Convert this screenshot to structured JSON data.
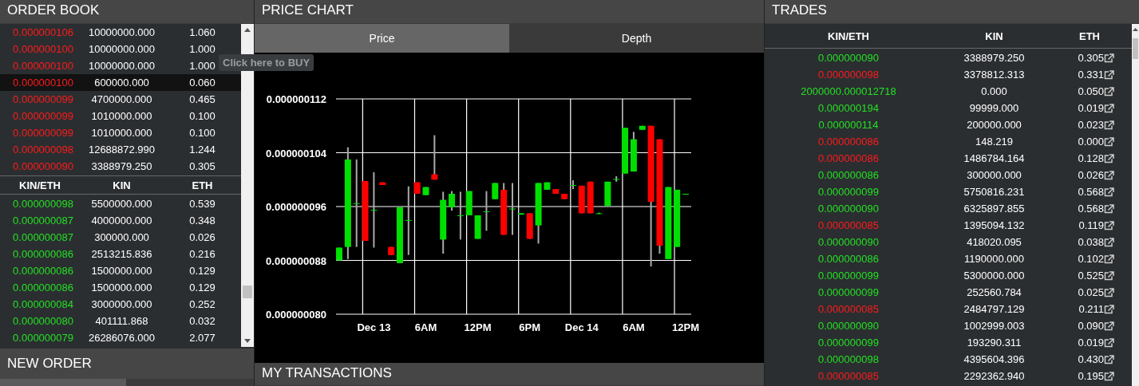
{
  "order_book": {
    "title": "ORDER BOOK",
    "sell_orders": [
      {
        "price": "0.000000106",
        "kin": "10000000.000",
        "eth": "1.060",
        "highlighted": false
      },
      {
        "price": "0.000000100",
        "kin": "10000000.000",
        "eth": "1.000",
        "highlighted": false
      },
      {
        "price": "0.000000100",
        "kin": "10000000.000",
        "eth": "1.000",
        "highlighted": false
      },
      {
        "price": "0.000000100",
        "kin": "600000.000",
        "eth": "0.060",
        "highlighted": true
      },
      {
        "price": "0.000000099",
        "kin": "4700000.000",
        "eth": "0.465",
        "highlighted": false
      },
      {
        "price": "0.000000099",
        "kin": "1010000.000",
        "eth": "0.100",
        "highlighted": false
      },
      {
        "price": "0.000000099",
        "kin": "1010000.000",
        "eth": "0.100",
        "highlighted": false
      },
      {
        "price": "0.000000098",
        "kin": "12688872.990",
        "eth": "1.244",
        "highlighted": false
      },
      {
        "price": "0.000000090",
        "kin": "3388979.250",
        "eth": "0.305",
        "highlighted": false
      }
    ],
    "columns": [
      "KIN/ETH",
      "KIN",
      "ETH"
    ],
    "buy_orders": [
      {
        "price": "0.000000098",
        "kin": "5500000.000",
        "eth": "0.539",
        "highlighted": false
      },
      {
        "price": "0.000000087",
        "kin": "4000000.000",
        "eth": "0.348",
        "highlighted": false
      },
      {
        "price": "0.000000087",
        "kin": "300000.000",
        "eth": "0.026",
        "highlighted": false
      },
      {
        "price": "0.000000086",
        "kin": "2513215.836",
        "eth": "0.216",
        "highlighted": false
      },
      {
        "price": "0.000000086",
        "kin": "1500000.000",
        "eth": "0.129",
        "highlighted": false
      },
      {
        "price": "0.000000086",
        "kin": "1500000.000",
        "eth": "0.129",
        "highlighted": false
      },
      {
        "price": "0.000000084",
        "kin": "3000000.000",
        "eth": "0.252",
        "highlighted": false
      },
      {
        "price": "0.000000080",
        "kin": "401111.868",
        "eth": "0.032",
        "highlighted": false
      },
      {
        "price": "0.000000079",
        "kin": "26286076.000",
        "eth": "2.077",
        "highlighted": false
      }
    ],
    "tooltip": "Click here to BUY"
  },
  "new_order": {
    "title": "NEW ORDER"
  },
  "price_chart": {
    "title": "PRICE CHART",
    "tabs": [
      {
        "label": "Price",
        "selected": true
      },
      {
        "label": "Depth",
        "selected": false
      }
    ],
    "chart_data": {
      "type": "candlestick",
      "categories": [
        null,
        null,
        null,
        null,
        "Dec 13",
        null,
        null,
        null,
        null,
        null,
        "6AM",
        null,
        null,
        null,
        null,
        null,
        "12PM",
        null,
        null,
        null,
        null,
        null,
        "6PM",
        null,
        null,
        null,
        null,
        null,
        "Dec 14",
        null,
        null,
        null,
        null,
        null,
        "6AM",
        null,
        null,
        null,
        null,
        null,
        "12PM"
      ],
      "grid": true,
      "ohlc": [
        [
          8.8e-08,
          8.99e-08,
          8.8e-08,
          8.99e-08
        ],
        [
          9e-08,
          1.048e-07,
          8.82e-08,
          1.03e-07
        ],
        [
          9.65e-08,
          1.03e-07,
          9e-08,
          9.65e-08
        ],
        [
          9.98e-08,
          9.98e-08,
          9.09e-08,
          9.09e-08
        ],
        [
          9.55e-08,
          1.011e-07,
          8.99e-08,
          9.55e-08
        ],
        [
          9.96e-08,
          9.96e-08,
          9.92e-08,
          9.92e-08
        ],
        [
          9e-08,
          9e-08,
          8.88e-08,
          8.88e-08
        ],
        [
          8.76e-08,
          9.59e-08,
          8.76e-08,
          9.59e-08
        ],
        [
          9.4e-08,
          9.9e-08,
          8.88e-08,
          9.4e-08
        ],
        [
          9.96e-08,
          9.96e-08,
          9.79e-08,
          9.79e-08
        ],
        [
          9.77e-08,
          9.89e-08,
          9.77e-08,
          9.89e-08
        ],
        [
          1.008e-07,
          1.066e-07,
          1e-07,
          1e-07
        ],
        [
          9.11e-08,
          9.82e-08,
          8.9e-08,
          9.7e-08
        ],
        [
          9.59e-08,
          9.83e-08,
          9.54e-08,
          9.79e-08
        ],
        [
          9.47e-08,
          9.82e-08,
          9.11e-08,
          9.47e-08
        ],
        [
          9.47e-08,
          9.83e-08,
          9.47e-08,
          9.83e-08
        ],
        [
          9.12e-08,
          9.47e-08,
          9.12e-08,
          9.47e-08
        ],
        [
          9.53e-08,
          9.83e-08,
          9.24e-08,
          9.53e-08
        ],
        [
          9.71e-08,
          9.95e-08,
          9.71e-08,
          9.95e-08
        ],
        [
          9.85e-08,
          9.95e-08,
          9.18e-08,
          9.18e-08
        ],
        [
          9.57e-08,
          9.95e-08,
          9.18e-08,
          9.57e-08
        ],
        [
          9.48e-08,
          9.5e-08,
          9.48e-08,
          9.5e-08
        ],
        [
          9.5e-08,
          9.5e-08,
          9.12e-08,
          9.12e-08
        ],
        [
          9.32e-08,
          9.95e-08,
          9.05e-08,
          9.95e-08
        ],
        [
          9.85e-08,
          9.96e-08,
          9.85e-08,
          9.96e-08
        ],
        [
          9.86e-08,
          9.86e-08,
          9.79e-08,
          9.79e-08
        ],
        [
          9.79e-08,
          9.79e-08,
          9.71e-08,
          9.71e-08
        ],
        [
          9.92e-08,
          9.99e-08,
          9.86e-08,
          9.92e-08
        ],
        [
          9.91e-08,
          9.91e-08,
          9.5e-08,
          9.5e-08
        ],
        [
          9.97e-08,
          9.97e-08,
          9.5e-08,
          9.5e-08
        ],
        [
          9.5e-08,
          9.51e-08,
          9.49e-08,
          9.5e-08
        ],
        [
          9.61e-08,
          9.97e-08,
          9.61e-08,
          9.97e-08
        ],
        [
          1.001e-07,
          1.005e-07,
          9.97e-08,
          1.001e-07
        ],
        [
          1.009e-07,
          1.077e-07,
          1.009e-07,
          1.077e-07
        ],
        [
          1.012e-07,
          1.071e-07,
          1.012e-07,
          1.06e-07
        ],
        [
          1.074e-07,
          1.08e-07,
          1.074e-07,
          1.08e-07
        ],
        [
          1.08e-07,
          1.08e-07,
          8.71e-08,
          9.67e-08
        ],
        [
          1.06e-07,
          1.06e-07,
          8.9e-08,
          9.02e-08
        ],
        [
          8.82e-08,
          9.89e-08,
          8.82e-08,
          9.89e-08
        ],
        [
          9e-08,
          9.85e-08,
          9e-08,
          9.85e-08
        ],
        [
          9.78e-08,
          9.79e-08,
          9.78e-08,
          9.79e-08
        ]
      ],
      "ylim": [
        8e-08,
        1.12e-07
      ],
      "yticks": [
        {
          "value": 1.12e-07,
          "label": "0.000000112"
        },
        {
          "value": 1.04e-07,
          "label": "0.000000104"
        },
        {
          "value": 9.6e-08,
          "label": "0.000000096"
        },
        {
          "value": 8.8e-08,
          "label": "0.000000088"
        },
        {
          "value": 8e-08,
          "label": "0.000000080"
        }
      ]
    }
  },
  "my_transactions": {
    "title": "MY TRANSACTIONS"
  },
  "trades": {
    "title": "TRADES",
    "columns": [
      "KIN/ETH",
      "KIN",
      "ETH"
    ],
    "rows": [
      {
        "price": "0.000000090",
        "kin": "3388979.250",
        "eth": "0.305",
        "color": "#22e022"
      },
      {
        "price": "0.000000098",
        "kin": "3378812.313",
        "eth": "0.331",
        "color": "#ff1a1a"
      },
      {
        "price": "2000000.000012718",
        "kin": "0.000",
        "eth": "0.050",
        "color": "#22e022"
      },
      {
        "price": "0.000000194",
        "kin": "99999.000",
        "eth": "0.019",
        "color": "#22e022"
      },
      {
        "price": "0.000000114",
        "kin": "200000.000",
        "eth": "0.023",
        "color": "#22e022"
      },
      {
        "price": "0.000000086",
        "kin": "148.219",
        "eth": "0.000",
        "color": "#ff1a1a"
      },
      {
        "price": "0.000000086",
        "kin": "1486784.164",
        "eth": "0.128",
        "color": "#ff1a1a"
      },
      {
        "price": "0.000000086",
        "kin": "300000.000",
        "eth": "0.026",
        "color": "#22e022"
      },
      {
        "price": "0.000000099",
        "kin": "5750816.231",
        "eth": "0.568",
        "color": "#22e022"
      },
      {
        "price": "0.000000090",
        "kin": "6325897.855",
        "eth": "0.568",
        "color": "#22e022"
      },
      {
        "price": "0.000000085",
        "kin": "1395094.132",
        "eth": "0.119",
        "color": "#ff1a1a"
      },
      {
        "price": "0.000000090",
        "kin": "418020.095",
        "eth": "0.038",
        "color": "#22e022"
      },
      {
        "price": "0.000000086",
        "kin": "1190000.000",
        "eth": "0.102",
        "color": "#22e022"
      },
      {
        "price": "0.000000099",
        "kin": "5300000.000",
        "eth": "0.525",
        "color": "#22e022"
      },
      {
        "price": "0.000000099",
        "kin": "252560.784",
        "eth": "0.025",
        "color": "#22e022"
      },
      {
        "price": "0.000000085",
        "kin": "2484797.129",
        "eth": "0.211",
        "color": "#ff1a1a"
      },
      {
        "price": "0.000000090",
        "kin": "1002999.003",
        "eth": "0.090",
        "color": "#22e022"
      },
      {
        "price": "0.000000099",
        "kin": "193290.311",
        "eth": "0.019",
        "color": "#22e022"
      },
      {
        "price": "0.000000098",
        "kin": "4395604.396",
        "eth": "0.430",
        "color": "#22e022"
      },
      {
        "price": "0.000000085",
        "kin": "2292362.940",
        "eth": "0.195",
        "color": "#ff1a1a"
      }
    ]
  }
}
